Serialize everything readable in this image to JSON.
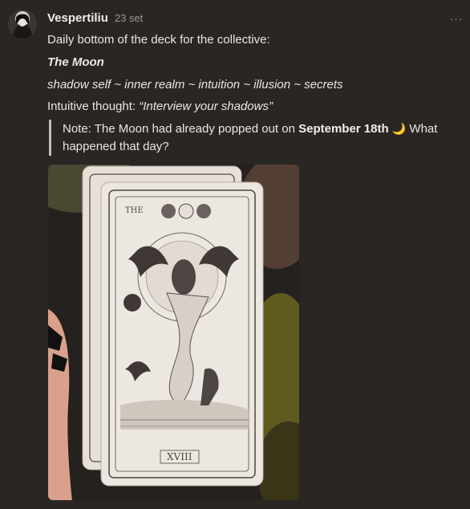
{
  "post": {
    "author": "Vespertiliu",
    "date": "23 set",
    "more_label": "···",
    "lines": {
      "intro": "Daily bottom of the deck for the collective:",
      "card_name": "The Moon",
      "keywords": "shadow self ~ inner realm ~ intuition ~ illusion ~ secrets",
      "thought_prefix": "Intuitive thought: ",
      "thought_quote": "“Interview your shadows”"
    },
    "note": {
      "prefix": "Note: The Moon had already popped out on ",
      "date_bold": "September 18th",
      "emoji": "🌙",
      "suffix": " What happened that day?"
    },
    "image": {
      "card_title": "THE",
      "card_numeral": "XVIII"
    }
  },
  "colors": {
    "background": "#2a2624",
    "text": "#ece6e2",
    "muted": "#9d9590",
    "quote_bar": "#c8bdb5",
    "card": "#ebe5df",
    "ink": "#4d4543"
  }
}
